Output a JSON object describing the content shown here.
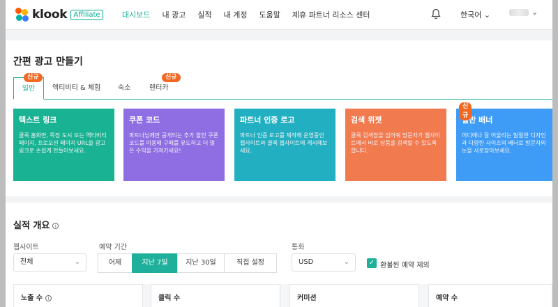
{
  "nav": {
    "logo_text": "klook",
    "logo_badge": "Affiliate",
    "menu": [
      "대시보드",
      "내 광고",
      "실적",
      "내 계정",
      "도움말",
      "제휴 파트너 리소스 센터"
    ],
    "language": "한국어",
    "chev": "⌄",
    "icons": {
      "bell": "bell-icon",
      "chevron": "chevron-down-icon"
    }
  },
  "quick_ad": {
    "title": "간편 광고 만들기",
    "tabs": [
      {
        "label": "일반",
        "badge": "신규"
      },
      {
        "label": "액티비티 & 체험",
        "badge": ""
      },
      {
        "label": "숙소",
        "badge": ""
      },
      {
        "label": "렌터카",
        "badge": "신규"
      }
    ],
    "cards": [
      {
        "title": "텍스트 링크",
        "desc": "클룩 홈화면, 특정 도시 또는 액티비티 페이지, 프로모션 페이지 URL을 광고 링크로 손쉽게 만들어보세요.",
        "badge": ""
      },
      {
        "title": "쿠폰 코드",
        "desc": "파트너님께만 공개되는 추가 할인 쿠폰 코드를 이용해 구매를 유도하고 더 많은 수익을 가져가세요!",
        "badge": ""
      },
      {
        "title": "파트너 인증 로고",
        "desc": "파트너 인증 로고를 제작해 운영중인 웹사이트와 클룩 웹사이트에 게시해보세요.",
        "badge": ""
      },
      {
        "title": "검색 위젯",
        "desc": "클룩 검색창을 심어줘 방문자가 웹사이트에서 바로 상품을 검색할 수 있도록 합니다.",
        "badge": ""
      },
      {
        "title": "일반 배너",
        "desc": "어디에나 잘 어울리는 발랄한 디자인과 다양한 사이즈의 배너로 방문자의 눈을 사로잡아보세요.",
        "badge": "신규"
      }
    ],
    "card_colors": [
      "#19b394",
      "#8f6ee4",
      "#23afc2",
      "#f27a4f",
      "#3f9cf6"
    ]
  },
  "performance": {
    "title": "실적 개요",
    "info": "i",
    "website_label": "웹사이트",
    "website_value": "전체",
    "period_label": "예약 기간",
    "period_options": [
      "어제",
      "지난 7일",
      "지난 30일",
      "직접 설정"
    ],
    "period_selected": "지난 7일",
    "currency_label": "통화",
    "currency_value": "USD",
    "exclude_label": "환불된 예약 제외",
    "checkmark": "✓",
    "stats": [
      "노출 수",
      "클릭 수",
      "커미션",
      "예약 수"
    ]
  },
  "accent_color": "#1eb09a",
  "badge_color": "#f26722"
}
